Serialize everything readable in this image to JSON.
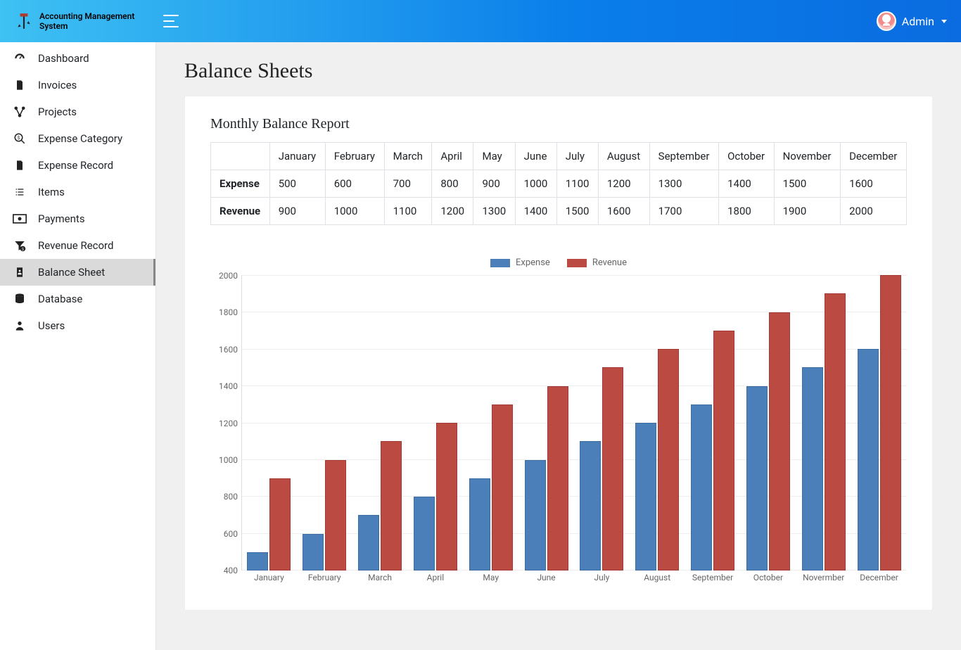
{
  "brand": {
    "title_line1": "Accounting Management",
    "title_line2": "System"
  },
  "user": {
    "name": "Admin"
  },
  "sidebar": {
    "items": [
      {
        "label": "Dashboard",
        "icon": "dashboard"
      },
      {
        "label": "Invoices",
        "icon": "invoice"
      },
      {
        "label": "Projects",
        "icon": "projects"
      },
      {
        "label": "Expense Category",
        "icon": "search-dollar"
      },
      {
        "label": "Expense Record",
        "icon": "file-alt"
      },
      {
        "label": "Items",
        "icon": "list"
      },
      {
        "label": "Payments",
        "icon": "money"
      },
      {
        "label": "Revenue Record",
        "icon": "filter-dollar"
      },
      {
        "label": "Balance Sheet",
        "icon": "user-doc",
        "active": true
      },
      {
        "label": "Database",
        "icon": "database"
      },
      {
        "label": "Users",
        "icon": "user"
      }
    ]
  },
  "page": {
    "title": "Balance Sheets",
    "report_title": "Monthly Balance Report"
  },
  "table": {
    "months": [
      "January",
      "February",
      "March",
      "April",
      "May",
      "June",
      "July",
      "August",
      "September",
      "October",
      "November",
      "December"
    ],
    "rows": [
      {
        "label": "Expense",
        "values": [
          500,
          600,
          700,
          800,
          900,
          1000,
          1100,
          1200,
          1300,
          1400,
          1500,
          1600
        ]
      },
      {
        "label": "Revenue",
        "values": [
          900,
          1000,
          1100,
          1200,
          1300,
          1400,
          1500,
          1600,
          1700,
          1800,
          1900,
          2000
        ]
      }
    ]
  },
  "chart_data": {
    "type": "bar",
    "categories": [
      "January",
      "February",
      "March",
      "April",
      "May",
      "June",
      "July",
      "August",
      "September",
      "October",
      "Novermber",
      "December"
    ],
    "series": [
      {
        "name": "Expense",
        "color": "#4a7fb9",
        "values": [
          500,
          600,
          700,
          800,
          900,
          1000,
          1100,
          1200,
          1300,
          1400,
          1500,
          1600
        ]
      },
      {
        "name": "Revenue",
        "color": "#bb4a43",
        "values": [
          900,
          1000,
          1100,
          1200,
          1300,
          1400,
          1500,
          1600,
          1700,
          1800,
          1900,
          2000
        ]
      }
    ],
    "ylim": [
      400,
      2000
    ],
    "yticks": [
      400,
      600,
      800,
      1000,
      1200,
      1400,
      1600,
      1800,
      2000
    ]
  }
}
